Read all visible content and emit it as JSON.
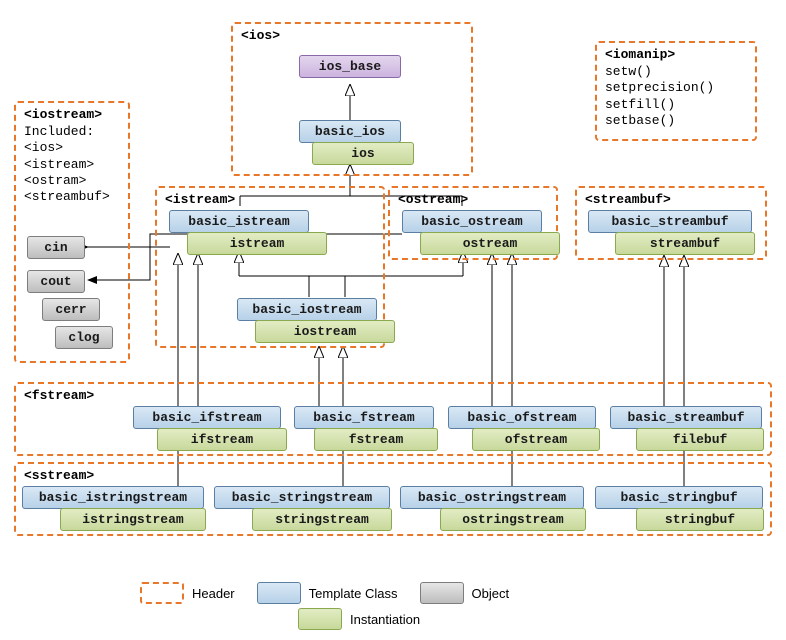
{
  "headers": {
    "ios": "<ios>",
    "iomanip": {
      "title": "<iomanip>",
      "lines": [
        "setw()",
        "setprecision()",
        "setfill()",
        "setbase()"
      ]
    },
    "iostream": {
      "title": "<iostream>",
      "lines": [
        "Included:",
        "<ios>",
        "<istream>",
        "<ostram>",
        "<streambuf>"
      ]
    },
    "istream": "<istream>",
    "ostream": "<ostream>",
    "streambuf": "<streambuf>",
    "fstream": "<fstream>",
    "sstream": "<sstream>"
  },
  "classes": {
    "ios_base": "ios_base",
    "basic_ios": "basic_ios",
    "ios": "ios",
    "basic_istream": "basic_istream",
    "istream": "istream",
    "basic_ostream": "basic_ostream",
    "ostream": "ostream",
    "basic_streambuf": "basic_streambuf",
    "streambuf": "streambuf",
    "basic_iostream": "basic_iostream",
    "iostream": "iostream",
    "basic_ifstream": "basic_ifstream",
    "ifstream": "ifstream",
    "basic_fstream": "basic_fstream",
    "fstream": "fstream",
    "basic_ofstream": "basic_ofstream",
    "ofstream": "ofstream",
    "basic_streambuf2": "basic_streambuf",
    "filebuf": "filebuf",
    "basic_istringstream": "basic_istringstream",
    "istringstream": "istringstream",
    "basic_stringstream": "basic_stringstream",
    "stringstream": "stringstream",
    "basic_ostringstream": "basic_ostringstream",
    "ostringstream": "ostringstream",
    "basic_stringbuf": "basic_stringbuf",
    "stringbuf": "stringbuf"
  },
  "objects": {
    "cin": "cin",
    "cout": "cout",
    "cerr": "cerr",
    "clog": "clog"
  },
  "legend": {
    "header": "Header",
    "tclass": "Template Class",
    "inst": "Instantiation",
    "obj": "Object"
  }
}
